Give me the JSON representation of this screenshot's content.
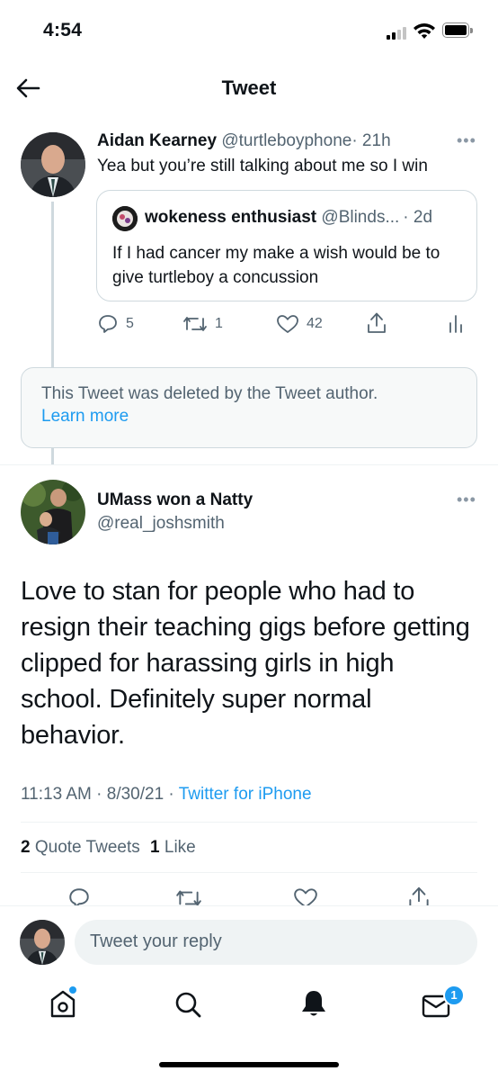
{
  "status": {
    "time": "4:54"
  },
  "header": {
    "title": "Tweet"
  },
  "parent_tweet": {
    "name": "Aidan Kearney",
    "handle": "@turtleboyphone",
    "time": "· 21h",
    "text": "Yea but you’re still talking about me so I win",
    "quote": {
      "name": "wokeness enthusiast",
      "handle": "@Blinds...",
      "time": "· 2d",
      "text": "If I had cancer my make a wish would be to give turtleboy a concussion"
    },
    "actions": {
      "replies": "5",
      "retweets": "1",
      "likes": "42"
    }
  },
  "deleted_notice": {
    "text": "This Tweet was deleted by the Tweet author.",
    "link": "Learn more"
  },
  "main_tweet": {
    "name": "UMass won a Natty",
    "handle": "@real_joshsmith",
    "text": "Love to stan for people who had to resign their teaching gigs before getting clipped for harassing girls in high school. Definitely super normal behavior.",
    "time": "11:13 AM · 8/30/21 ·",
    "source": "Twitter for iPhone",
    "stats": {
      "quote_count": "2",
      "quote_label": "Quote Tweets",
      "like_count": "1",
      "like_label": "Like"
    }
  },
  "reply": {
    "placeholder": "Tweet your reply"
  },
  "tabbar": {
    "messages_badge": "1"
  },
  "colors": {
    "accent": "#1d9bf0",
    "muted": "#536471",
    "border": "#cfd9de"
  },
  "icons": [
    "back-arrow-icon",
    "more-icon",
    "reply-icon",
    "retweet-icon",
    "like-icon",
    "share-icon",
    "analytics-icon",
    "home-icon",
    "search-icon",
    "notifications-icon",
    "messages-icon"
  ]
}
